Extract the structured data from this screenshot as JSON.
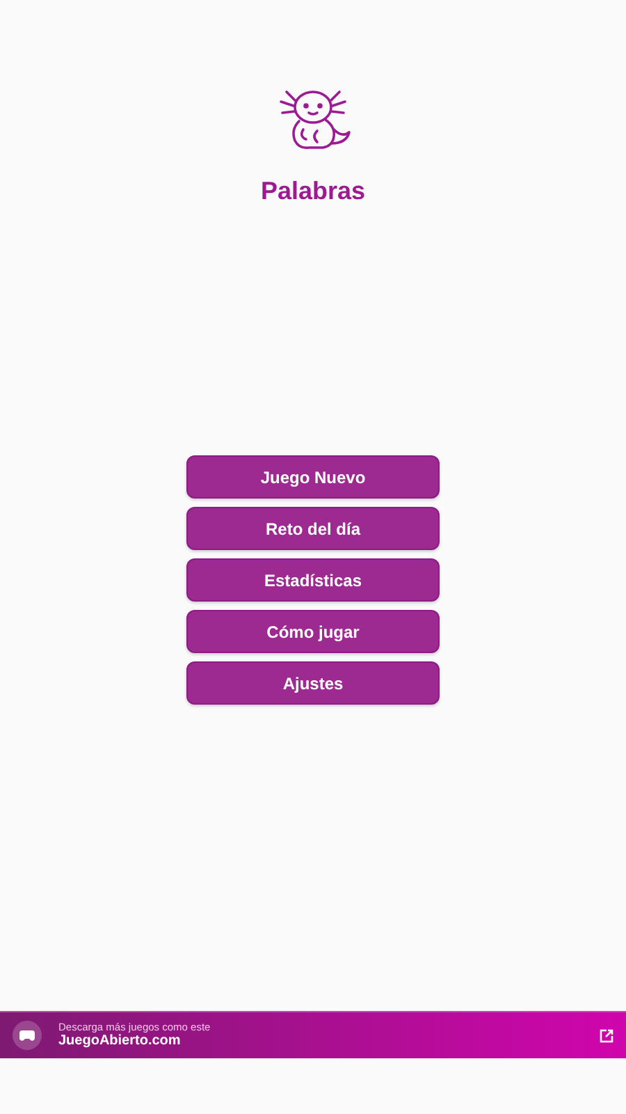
{
  "app": {
    "title": "Palabras"
  },
  "menu": [
    {
      "label": "Juego Nuevo"
    },
    {
      "label": "Reto del día"
    },
    {
      "label": "Estadísticas"
    },
    {
      "label": "Cómo jugar"
    },
    {
      "label": "Ajustes"
    }
  ],
  "banner": {
    "caption": "Descarga más juegos como este",
    "site": "JuegoAbierto.com"
  }
}
